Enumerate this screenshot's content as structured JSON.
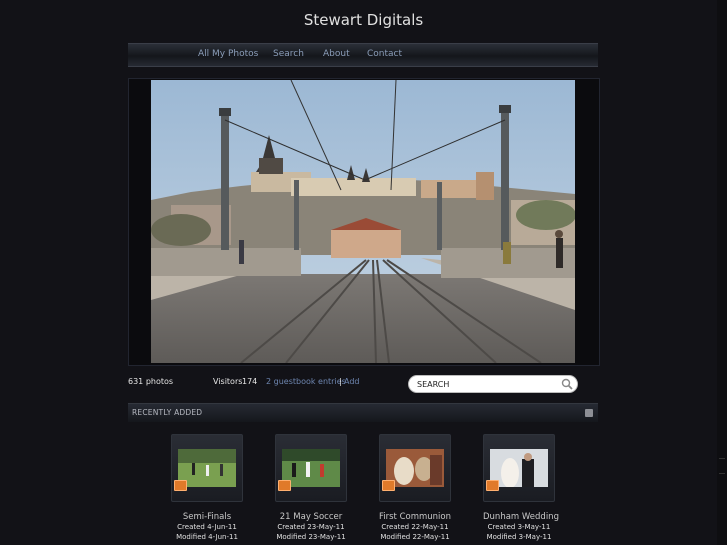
{
  "site": {
    "title": "Stewart Digitals"
  },
  "nav": [
    {
      "label": "All My Photos"
    },
    {
      "label": "Search"
    },
    {
      "label": "About"
    },
    {
      "label": "Contact"
    }
  ],
  "stats": {
    "photos": "631 photos",
    "visitors_label": "Visitors",
    "visitors_count": "174",
    "guestbook": "2 guestbook entries",
    "separator": "|",
    "add": "Add"
  },
  "search": {
    "placeholder": "SEARCH",
    "icon": "magnifier-icon"
  },
  "recent": {
    "title": "RECENTLY ADDED",
    "icon": "rss-icon"
  },
  "albums": [
    {
      "title": "Semi-Finals",
      "created": "Created 4-Jun-11",
      "modified": "Modified 4-Jun-11"
    },
    {
      "title": "21 May Soccer",
      "created": "Created 23-May-11",
      "modified": "Modified 23-May-11"
    },
    {
      "title": "First Communion",
      "created": "Created 22-May-11",
      "modified": "Modified 22-May-11"
    },
    {
      "title": "Dunham Wedding",
      "created": "Created 3-May-11",
      "modified": "Modified 3-May-11"
    }
  ],
  "colors": {
    "background": "#121217",
    "nav_link": "#8a9db8",
    "accent_link": "#6e86b0"
  }
}
